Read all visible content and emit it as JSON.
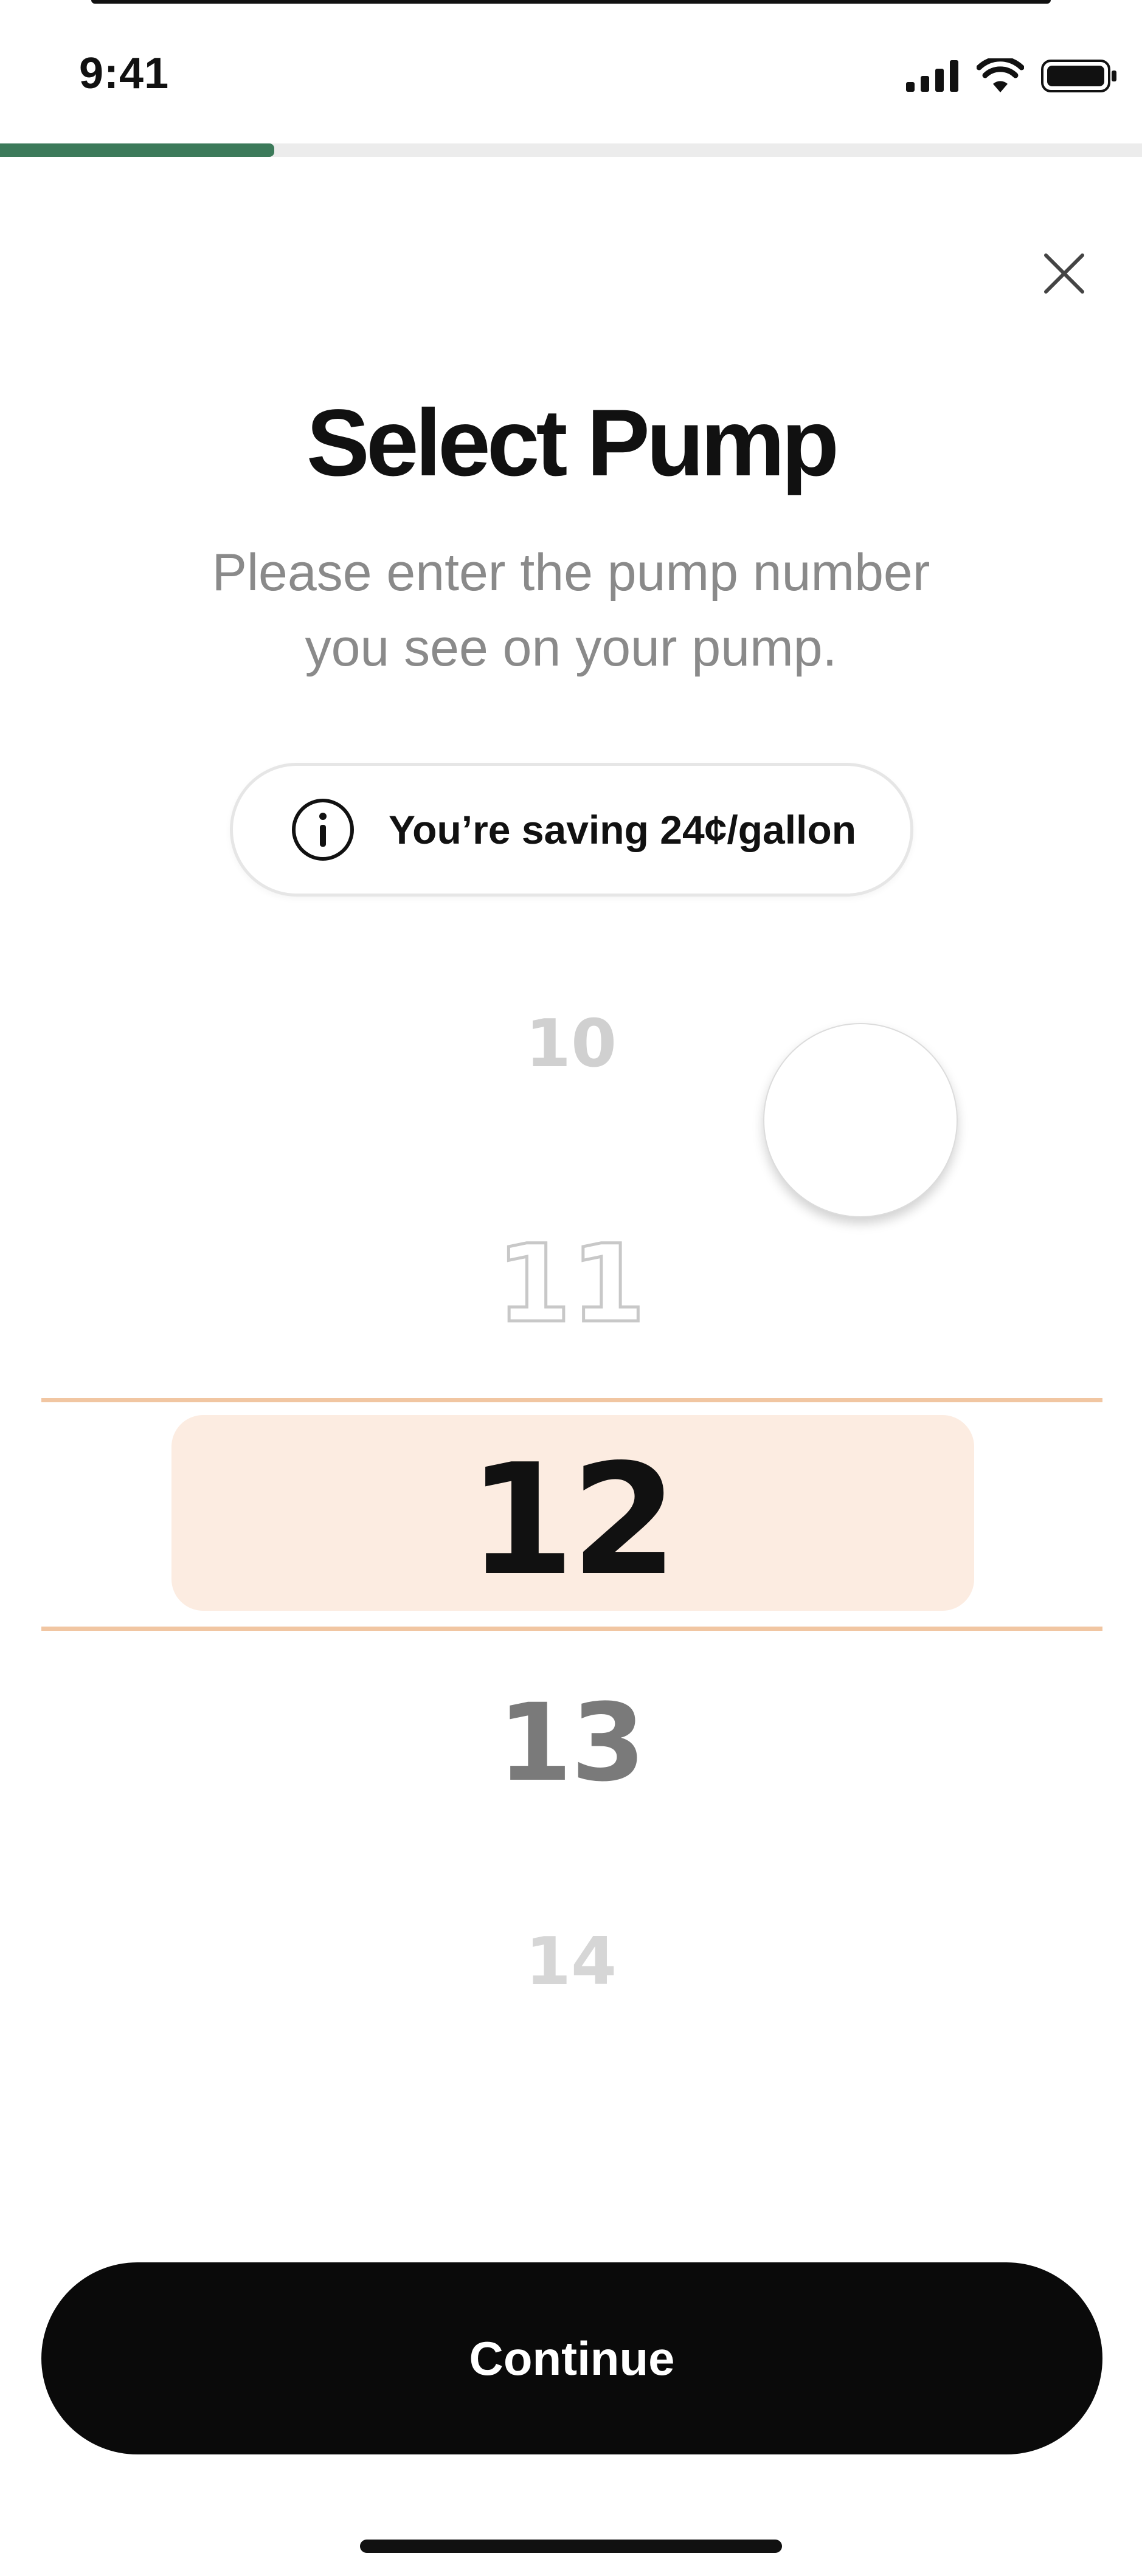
{
  "status_bar": {
    "time": "9:41",
    "icons": [
      "signal-icon",
      "wifi-icon",
      "battery-icon"
    ]
  },
  "progress": {
    "value": 0.24,
    "color": "#3c7a5a"
  },
  "header": {
    "close_icon": "close-icon",
    "title": "Select Pump",
    "subtitle_line1": "Please enter the pump number",
    "subtitle_line2": "you see on your pump."
  },
  "savings": {
    "icon": "info-icon",
    "text": "You’re saving 24¢/gallon"
  },
  "picker": {
    "options": [
      "10",
      "11",
      "12",
      "13",
      "14"
    ],
    "selected": "12",
    "highlight_color": "#fcece1",
    "line_color": "#f1c6a2"
  },
  "footer": {
    "continue_label": "Continue"
  }
}
